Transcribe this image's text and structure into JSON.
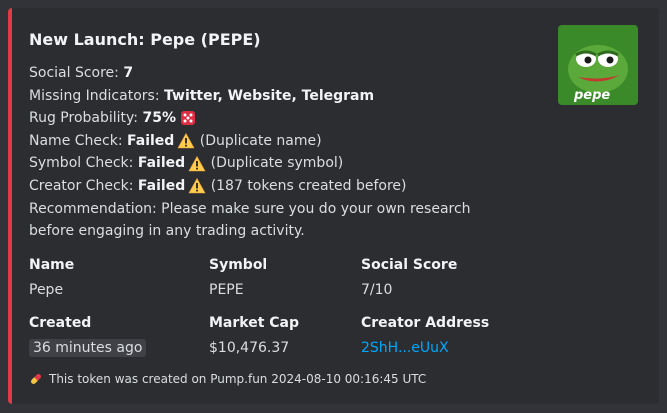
{
  "embed": {
    "accent_color": "#e03a46",
    "title": "New Launch: Pepe (PEPE)",
    "thumbnail": {
      "icon": "pepe-frog-logo",
      "caption": "pepe"
    },
    "lines": {
      "social_score_label": "Social Score: ",
      "social_score_value": "7",
      "missing_label": "Missing Indicators: ",
      "missing_value": "Twitter, Website, Telegram",
      "rug_label": "Rug Probability: ",
      "rug_value": "75%",
      "rug_icon": "dice-icon",
      "name_check_label": "Name Check: ",
      "name_check_value": "Failed",
      "name_check_note": "(Duplicate name)",
      "symbol_check_label": "Symbol Check: ",
      "symbol_check_value": "Failed",
      "symbol_check_note": "(Duplicate symbol)",
      "creator_check_label": "Creator Check: ",
      "creator_check_value": "Failed",
      "creator_check_note": "(187 tokens created before)",
      "warning_icon": "warning-icon",
      "recommendation_1": "Recommendation: Please make sure you do your own research",
      "recommendation_2": "before engaging in any trading activity."
    },
    "fields": {
      "name_label": "Name",
      "name_value": "Pepe",
      "symbol_label": "Symbol",
      "symbol_value": "PEPE",
      "social_label": "Social Score",
      "social_value": "7/10",
      "created_label": "Created",
      "created_value": "36 minutes ago",
      "mcap_label": "Market Cap",
      "mcap_value": "$10,476.37",
      "creator_label": "Creator Address",
      "creator_value": "2ShH...eUuX"
    },
    "footer": {
      "icon": "pill-icon",
      "text": "This token was created on Pump.fun 2024-08-10 00:16:45 UTC"
    }
  }
}
